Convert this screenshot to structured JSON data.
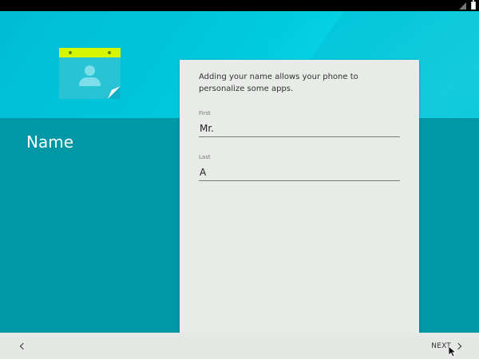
{
  "status_bar": {
    "icons": [
      "signal-icon",
      "battery-icon"
    ]
  },
  "page": {
    "title": "Name"
  },
  "form": {
    "description": "Adding your name allows your phone to personalize some apps.",
    "first": {
      "label": "First",
      "value": "Mr."
    },
    "last": {
      "label": "Last",
      "value": "A"
    }
  },
  "nav": {
    "back_icon": "chevron-left-icon",
    "next_label": "NEXT",
    "next_icon": "chevron-right-icon"
  },
  "colors": {
    "hero": "#00bcd4",
    "background": "#0097a7",
    "card": "#e8ebe8",
    "accent_yellow": "#d6f500"
  }
}
